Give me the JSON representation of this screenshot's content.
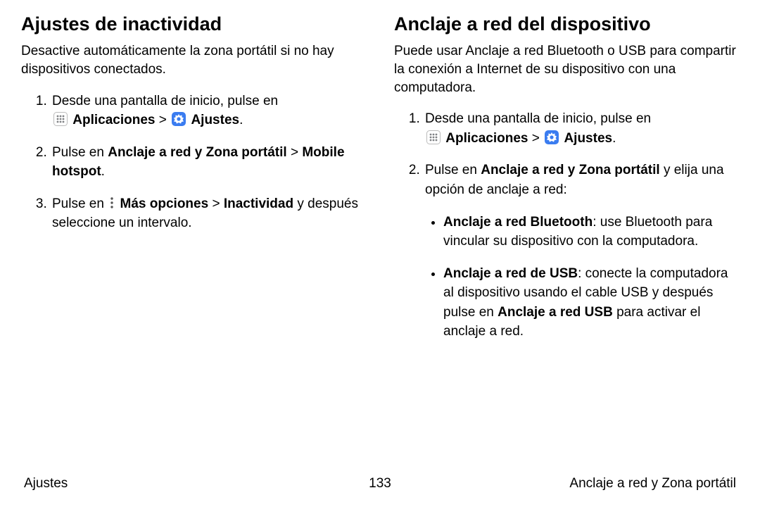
{
  "left": {
    "heading": "Ajustes de inactividad",
    "lead": "Desactive automáticamente la zona portátil si no hay dispositivos conectados.",
    "steps": {
      "s1_pre": "Desde una pantalla de inicio, pulse en ",
      "apps_label": "Aplicaciones",
      "sep": " > ",
      "settings_label": "Ajustes",
      "period": ".",
      "s2_pre": "Pulse en ",
      "s2_b1": "Anclaje a red y Zona portátil",
      "s2_sep": " > ",
      "s2_b2": "Mobile hotspot",
      "s3_pre": "Pulse en ",
      "s3_b1": "Más opciones",
      "s3_sep": " > ",
      "s3_b2": "Inactividad",
      "s3_post": " y después seleccione un intervalo."
    }
  },
  "right": {
    "heading": "Anclaje a red del dispositivo",
    "lead": "Puede usar Anclaje a red Bluetooth o USB para compartir la conexión a Internet de su dispositivo con una computadora.",
    "steps": {
      "s1_pre": "Desde una pantalla de inicio, pulse en ",
      "apps_label": "Aplicaciones",
      "sep": " > ",
      "settings_label": "Ajustes",
      "period": ".",
      "s2_pre": "Pulse en ",
      "s2_b1": "Anclaje a red y Zona portátil",
      "s2_post": " y elija una opción de anclaje a red:",
      "sub": {
        "bt_b": "Anclaje a red Bluetooth",
        "bt_post": ": use Bluetooth para vincular su dispositivo con la computadora.",
        "usb_b": "Anclaje a red de USB",
        "usb_mid1": ": conecte la computadora al dispositivo usando el cable USB y después pulse en ",
        "usb_b2": "Anclaje a red USB",
        "usb_post": " para activar el anclaje a red."
      }
    }
  },
  "footer": {
    "left": "Ajustes",
    "center": "133",
    "right": "Anclaje a red y Zona portátil"
  }
}
